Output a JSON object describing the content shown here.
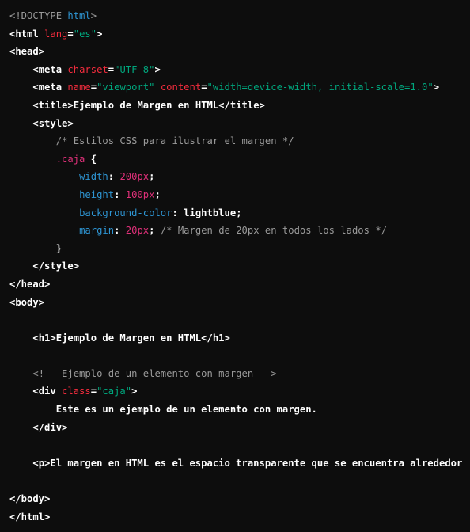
{
  "colors": {
    "background": "#0d0d0d",
    "tag": "#ffffff",
    "attribute": "#f22c3d",
    "string": "#00a67d",
    "keyword": "#2e95d3",
    "comment": "#9a9a9a",
    "number": "#df3079"
  },
  "code": {
    "l1": {
      "a": "<!DOCTYPE ",
      "b": "html",
      "c": ">"
    },
    "l2": {
      "a": "<html ",
      "b": "lang",
      "c": "=",
      "d": "\"es\"",
      "e": ">"
    },
    "l3": {
      "a": "<head>"
    },
    "l4": {
      "a": "<meta ",
      "b": "charset",
      "c": "=",
      "d": "\"UTF-8\"",
      "e": ">"
    },
    "l5": {
      "a": "<meta ",
      "b": "name",
      "c": "=",
      "d": "\"viewport\"",
      "e": " ",
      "f": "content",
      "g": "=",
      "h": "\"width=device-width, initial-scale=1.0\"",
      "i": ">"
    },
    "l6": {
      "a": "<title>",
      "b": "Ejemplo de Margen en HTML",
      "c": "</title>"
    },
    "l7": {
      "a": "<style>"
    },
    "l8": {
      "a": "/* Estilos CSS para ilustrar el margen */"
    },
    "l9": {
      "a": ".caja",
      "b": " {"
    },
    "l10": {
      "a": "width",
      "b": ": ",
      "c": "200px",
      "d": ";"
    },
    "l11": {
      "a": "height",
      "b": ": ",
      "c": "100px",
      "d": ";"
    },
    "l12": {
      "a": "background-color",
      "b": ": ",
      "c": "lightblue",
      "d": ";"
    },
    "l13": {
      "a": "margin",
      "b": ": ",
      "c": "20px",
      "d": "; ",
      "e": "/* Margen de 20px en todos los lados */"
    },
    "l14": {
      "a": "}"
    },
    "l15": {
      "a": "</style>"
    },
    "l16": {
      "a": "</head>"
    },
    "l17": {
      "a": "<body>"
    },
    "l19": {
      "a": "<h1>Ejemplo de Margen en HTML</h1>"
    },
    "l21": {
      "a": "<!-- Ejemplo de un elemento con margen -->"
    },
    "l22": {
      "a": "<div ",
      "b": "class",
      "c": "=",
      "d": "\"caja\"",
      "e": ">"
    },
    "l23": {
      "a": "Este es un ejemplo de un elemento con margen."
    },
    "l24": {
      "a": "</div>"
    },
    "l26": {
      "a": "<p>El margen en HTML es el espacio transparente que se encuentra alrededor"
    },
    "l28": {
      "a": "</body>"
    },
    "l29": {
      "a": "</html>"
    }
  }
}
